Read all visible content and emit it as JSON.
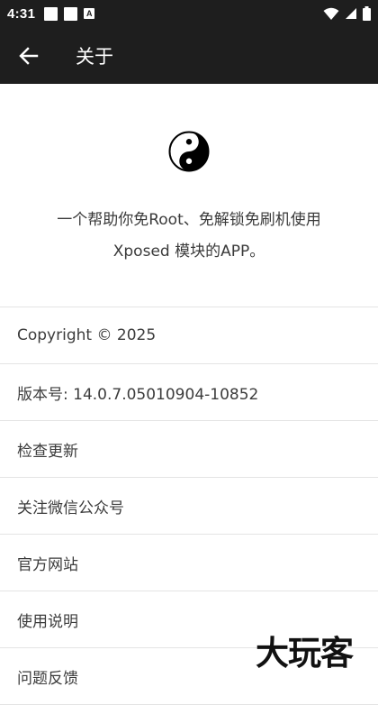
{
  "status_bar": {
    "time": "4:31",
    "noti_letter": "A",
    "icons": [
      "image-notification-icon",
      "image-notification-icon",
      "accessibility-a-icon",
      "wifi-icon",
      "signal-icon",
      "battery-icon"
    ]
  },
  "app_bar": {
    "title": "关于",
    "back_icon": "arrow-left-icon"
  },
  "hero": {
    "logo_icon": "yin-yang-icon",
    "description_line1": "一个帮助你免Root、免解锁免刷机使用",
    "description_line2": "Xposed 模块的APP。"
  },
  "menu": {
    "items": [
      {
        "label": "Copyright © 2025",
        "interactable": false
      },
      {
        "label": "版本号: 14.0.7.05010904-10852",
        "interactable": false
      },
      {
        "label": "检查更新",
        "interactable": true
      },
      {
        "label": "关注微信公众号",
        "interactable": true
      },
      {
        "label": "官方网站",
        "interactable": true
      },
      {
        "label": "使用说明",
        "interactable": true
      },
      {
        "label": "问题反馈",
        "interactable": true
      }
    ]
  },
  "watermark": "大玩客",
  "colors": {
    "bar_background": "#1e1e1e",
    "divider": "#e4e4e4",
    "text": "#3c3c3c"
  }
}
